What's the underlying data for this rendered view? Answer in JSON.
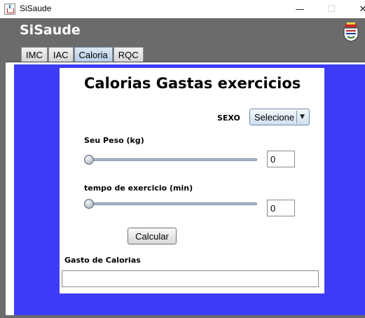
{
  "window": {
    "title": "SiSaude",
    "minimize_symbol": "—",
    "maximize_symbol": "☐",
    "close_symbol": "✕"
  },
  "header": {
    "brand": "SiSaude",
    "logo_icon": "crest-emblem-icon"
  },
  "tabs": [
    {
      "label": "IMC",
      "active": false
    },
    {
      "label": "IAC",
      "active": false
    },
    {
      "label": "Caloria",
      "active": true
    },
    {
      "label": "RQC",
      "active": false
    }
  ],
  "form": {
    "title": "Calorias Gastas exercicios",
    "sexo_label": "SEXO",
    "sexo_select": {
      "value": "Selecione",
      "arrow": "▼"
    },
    "peso_label": "Seu Peso (kg)",
    "peso_value": "0",
    "peso_slider_fraction": 0,
    "tempo_label": "tempo de exercicio (min)",
    "tempo_value": "0",
    "tempo_slider_fraction": 0,
    "calcular_button": "Calcular",
    "gasto_label": "Gasto de Calorias",
    "gasto_value": ""
  },
  "colors": {
    "header_gray": "#6b6b6b",
    "content_blue": "#3f3cf7",
    "panel_white": "#ffffff"
  }
}
